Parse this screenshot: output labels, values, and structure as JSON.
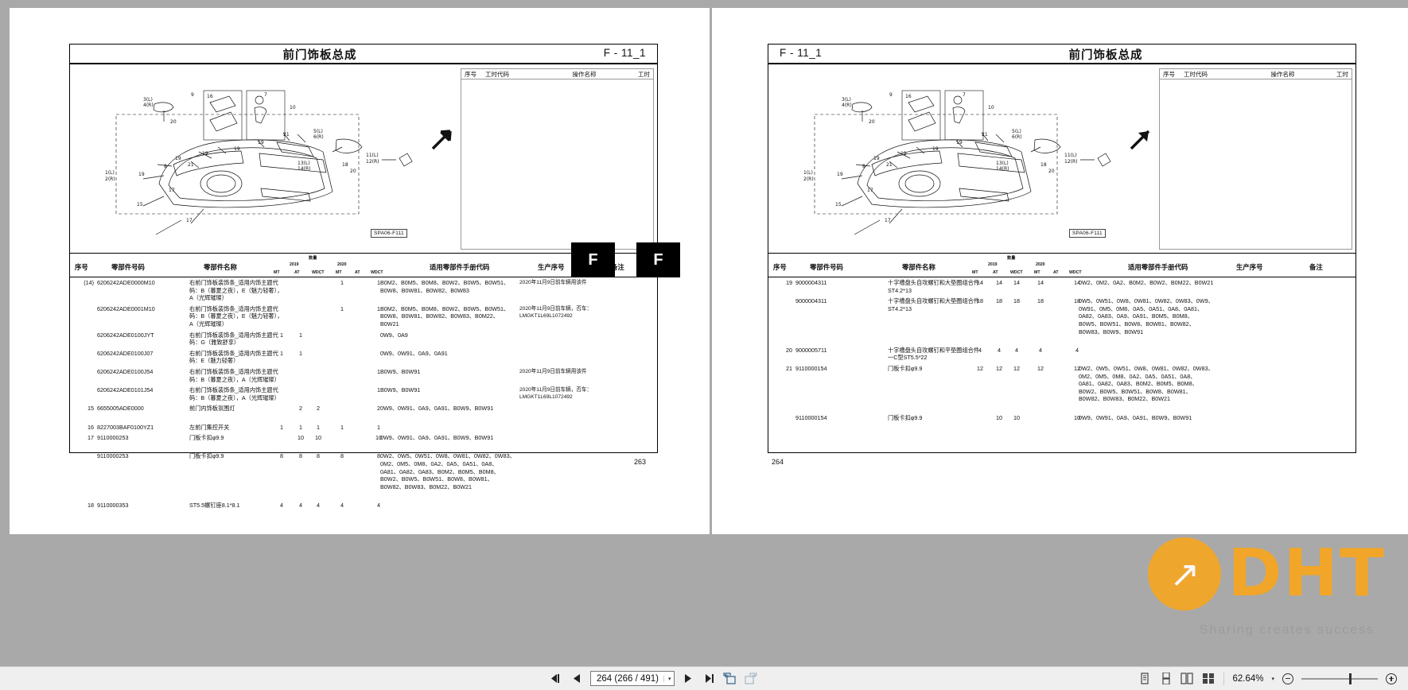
{
  "document": {
    "section_code": "F - 11_1",
    "title": "前门饰板总成",
    "tab_letter": "F",
    "diagram_tag": "SPA06-F111",
    "left_page_number": "263",
    "right_page_number": "264"
  },
  "operation_table": {
    "headers": [
      "序号",
      "工时代码",
      "操作名称",
      "工时"
    ]
  },
  "parts_table": {
    "headers": {
      "seq": "序号",
      "part_no": "零部件号码",
      "part_name": "零部件名称",
      "qty_group": "数量",
      "year_2019": "2019",
      "year_2020": "2020",
      "sub": [
        "MT",
        "AT",
        "WDCT",
        "MT",
        "AT",
        "WDCT"
      ],
      "applicable": "适用零部件手册代码",
      "production_seq": "生产序号",
      "remark": "备注"
    }
  },
  "left_rows": [
    {
      "seq": "(14)",
      "part_no": "6206242ADE0000M10",
      "name": "右前门饰板装饰条_适用内饰主题代码：B（暮夏之夜），E（魅力轻奢），A（光辉璀璨）",
      "qty": [
        "",
        "",
        "",
        "1",
        "",
        "1"
      ],
      "codes": "B0M2、B0M5、B0M8、B0W2、B0W5、B0W51、B0W8、B0W81、B0W82、B0W83",
      "prod": "2020年11月9日前车辆用该件",
      "remark": ""
    },
    {
      "seq": "",
      "part_no": "6206242ADE0001M10",
      "name": "右前门饰板装饰条_适用内饰主题代码：B（暮夏之夜），E（魅力轻奢），A（光辉璀璨）",
      "qty": [
        "",
        "",
        "",
        "1",
        "",
        "1"
      ],
      "codes": "B0M2、B0M5、B0M8、B0W2、B0W5、B0W51、B0W8、B0W81、B0W82、B0W83、B0M22、B0W21",
      "prod": "2020年11月9日前车辆，否车：LMGKT1L69L1072492",
      "remark": ""
    },
    {
      "seq": "",
      "part_no": "6206242ADE0100JYT",
      "name": "右前门饰板装饰条_适用内饰主题代码：G（雅致舒享）",
      "qty": [
        "1",
        "1",
        "",
        "",
        "",
        ""
      ],
      "codes": "0W9、0A9",
      "prod": "",
      "remark": ""
    },
    {
      "seq": "",
      "part_no": "6206242ADE0100J07",
      "name": "右前门饰板装饰条_适用内饰主题代码：E（魅力轻奢）",
      "qty": [
        "1",
        "1",
        "",
        "",
        "",
        ""
      ],
      "codes": "0W9、0W91、0A9、0A91",
      "prod": "",
      "remark": ""
    },
    {
      "seq": "",
      "part_no": "6206242ADE0100J54",
      "name": "右前门饰板装饰条_适用内饰主题代码：B（暮夏之夜），A（光辉璀璨）",
      "qty": [
        "",
        "",
        "",
        "",
        "",
        "1"
      ],
      "codes": "B0W9、B0W91",
      "prod": "2020年11月9日前车辆用该件",
      "remark": ""
    },
    {
      "seq": "",
      "part_no": "6206242ADE0101J54",
      "name": "右前门饰板装饰条_适用内饰主题代码：B（暮夏之夜），A（光辉璀璨）",
      "qty": [
        "",
        "",
        "",
        "",
        "",
        "1"
      ],
      "codes": "B0W9、B0W91",
      "prod": "2020年11月9日前车辆，否车：LMGKT1L69L1072492",
      "remark": ""
    },
    {
      "seq": "15",
      "part_no": "6655005ADE0000",
      "name": "前门内饰板氛围灯",
      "qty": [
        "",
        "2",
        "2",
        "",
        "",
        "2"
      ],
      "codes": "0W9、0W91、0A9、0A91、B0W9、B0W91",
      "prod": "",
      "remark": ""
    },
    {
      "seq": "16",
      "part_no": "8227003BAF0100YZ1",
      "name": "左前门集控开关",
      "qty": [
        "1",
        "1",
        "1",
        "1",
        "",
        "1"
      ],
      "codes": "",
      "prod": "",
      "remark": ""
    },
    {
      "seq": "17",
      "part_no": "9110000253",
      "name": "门板卡扣φ9.9",
      "qty": [
        "",
        "10",
        "10",
        "",
        "",
        "10"
      ],
      "codes": "0W9、0W91、0A9、0A91、B0W9、B0W91",
      "prod": "",
      "remark": ""
    },
    {
      "seq": "",
      "part_no": "9110000253",
      "name": "门板卡扣φ9.9",
      "qty": [
        "8",
        "8",
        "8",
        "8",
        "",
        "8"
      ],
      "codes": "0W2、0W5、0W51、0W8、0W81、0W82、0W83、0M2、0M5、0M8、0A2、0A5、0A51、0A8、0A81、0A82、0A83、B0M2、B0M5、B0M8、B0W2、B0W5、B0W51、B0W8、B0W81、B0W82、B0W83、B0M22、B0W21",
      "prod": "",
      "remark": ""
    },
    {
      "seq": "18",
      "part_no": "9110000353",
      "name": "ST5.5螺钉座8.1*8.1",
      "qty": [
        "4",
        "4",
        "4",
        "4",
        "",
        "4"
      ],
      "codes": "",
      "prod": "",
      "remark": ""
    }
  ],
  "right_rows": [
    {
      "seq": "19",
      "part_no": "9000004311",
      "name": "十字槽盘头自攻螺钉和大垫圈组合件ST4.2*13",
      "qty": [
        "14",
        "14",
        "14",
        "14",
        "",
        "14"
      ],
      "codes": "0W2、0M2、0A2、B0M2、B0W2、B0M22、B0W21",
      "prod": "",
      "remark": ""
    },
    {
      "seq": "",
      "part_no": "9000004311",
      "name": "十字槽盘头自攻螺钉和大垫圈组合件ST4.2*13",
      "qty": [
        "18",
        "18",
        "18",
        "18",
        "",
        "18"
      ],
      "codes": "0W5、0W51、0W8、0W81、0W82、0W83、0W9、0W91、0M5、0M8、0A5、0A51、0A8、0A81、0A82、0A83、0A9、0A91、B0M5、B0M8、B0W5、B0W51、B0W8、B0W81、B0W82、B0W83、B0W9、B0W91",
      "prod": "",
      "remark": ""
    },
    {
      "seq": "20",
      "part_no": "9000005711",
      "name": "十字槽盘头自攻螺钉和平垫圈组合件一C型ST5.5*22",
      "qty": [
        "4",
        "4",
        "4",
        "4",
        "",
        "4"
      ],
      "codes": "",
      "prod": "",
      "remark": ""
    },
    {
      "seq": "21",
      "part_no": "9110000154",
      "name": "门板卡扣φ9.9",
      "qty": [
        "12",
        "12",
        "12",
        "12",
        "",
        "12"
      ],
      "codes": "0W2、0W5、0W51、0W8、0W81、0W82、0W83、0M2、0M5、0M8、0A2、0A5、0A51、0A8、0A81、0A82、0A83、B0M2、B0M5、B0M8、B0W2、B0W5、B0W51、B0W8、B0W81、B0W82、B0W83、B0M22、B0W21",
      "prod": "",
      "remark": ""
    },
    {
      "seq": "",
      "part_no": "9110000154",
      "name": "门板卡扣φ9.9",
      "qty": [
        "",
        "10",
        "10",
        "",
        "",
        "10"
      ],
      "codes": "0W9、0W91、0A9、0A91、B0W9、B0W91",
      "prod": "",
      "remark": ""
    }
  ],
  "toolbar": {
    "first_page": "first-page",
    "prev_page": "previous-page",
    "page_value": "264 (266 / 491)",
    "next_page": "next-page",
    "last_page": "last-page",
    "zoom_level": "62.64%",
    "caret": "▾"
  },
  "watermark": {
    "text": "DHT",
    "tagline": "Sharing creates success"
  },
  "colors": {
    "page_bg": "#a9a9a9",
    "paper": "#ffffff",
    "tab_black": "#000000",
    "toolbar_bg": "#efefef",
    "watermark_orange": "#f5a623"
  }
}
